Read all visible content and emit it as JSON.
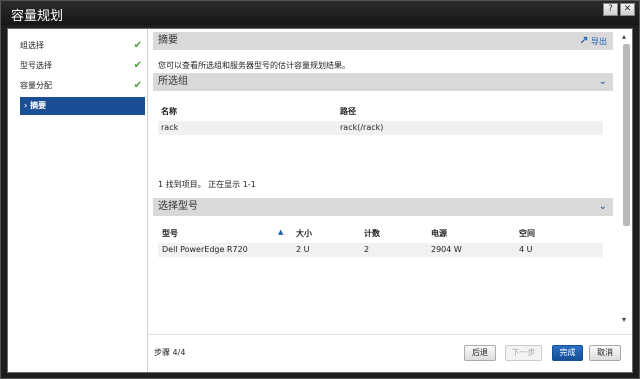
{
  "window": {
    "title": "容量规划",
    "help_icon": "?",
    "close_icon": "✕"
  },
  "sidebar": {
    "steps": [
      {
        "label": "组选择",
        "done": true
      },
      {
        "label": "型号选择",
        "done": true
      },
      {
        "label": "容量分配",
        "done": true
      },
      {
        "label": "摘要",
        "active": true,
        "prefix": "›"
      }
    ],
    "check_glyph": "✔"
  },
  "summary": {
    "title": "摘要",
    "export_label": "导出",
    "export_icon": "↗",
    "description": "您可以查看所选组和服务器型号的估计容量规划结果。"
  },
  "selected_groups": {
    "title": "所选组",
    "columns": [
      "名称",
      "路径"
    ],
    "rows": [
      [
        "rack",
        "rack(/rack)"
      ]
    ],
    "status": "1 找到项目。 正在显示 1-1"
  },
  "model_select": {
    "title": "选择型号",
    "columns": [
      "型号",
      "大小",
      "计数",
      "电源",
      "空间"
    ],
    "rows": [
      [
        "Dell PowerEdge R720",
        "2 U",
        "2",
        "2904 W",
        "4 U"
      ]
    ]
  },
  "footer": {
    "step_count": "步骤 4/4",
    "back_label": "后退",
    "next_label": "下一步",
    "finish_label": "完成",
    "cancel_label": "取消"
  },
  "colors": {
    "accent": "#1a4f95",
    "check": "#4aa03c"
  }
}
